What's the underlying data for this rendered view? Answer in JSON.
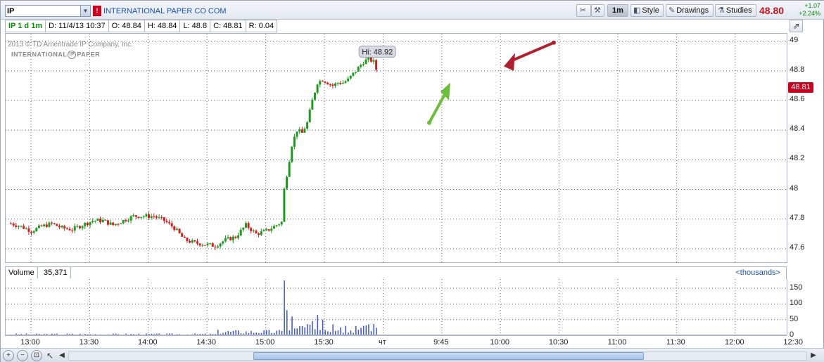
{
  "toolbar": {
    "symbol": "IP",
    "symbol_dropdown_icon": "chevron-down-icon",
    "alert_flag_label": "!",
    "company_name": "INTERNATIONAL PAPER CO COM",
    "interval_label": "1m",
    "style_label": "Style",
    "drawings_label": "Drawings",
    "studies_label": "Studies",
    "last_price": "48.80",
    "change_abs": "+1.07",
    "change_pct": "+2.24%"
  },
  "infobar": {
    "title": "IP 1 d 1m",
    "date": "D: 11/4/13 10:37",
    "open": "O: 48.84",
    "high": "H: 48.84",
    "low": "L: 48.8",
    "close": "C: 48.81",
    "range": "R: 0.04"
  },
  "watermark": {
    "copyright": "2013 © TD Ameritrade IP Company, Inc.",
    "logo_left": "INTERNATIONAL",
    "logo_mark": "IP",
    "logo_right": "PAPER"
  },
  "price_axis": {
    "last_price_tag": "48.81"
  },
  "annotations": {
    "hi_label": "Hi: 48.92"
  },
  "volume": {
    "label": "Volume",
    "value": "35,371",
    "units": "<thousands>"
  },
  "bottombar": {
    "zoom_in_icon": "+",
    "zoom_out_icon": "−",
    "zoom_fit_icon": "⊡",
    "zoom_reset_icon": "○",
    "cursor_icon": "↖",
    "scroll_left_icon": "◀",
    "scroll_right_icon": "▶"
  },
  "colors": {
    "up": "#1e9a1e",
    "down": "#d21e1e",
    "grid": "#666666",
    "volume": "#3a55c8",
    "arrow_green": "#6cbf3a",
    "arrow_red": "#b0202e",
    "last_price": "#cc1020"
  },
  "chart_data": [
    {
      "type": "candlestick",
      "series": [
        {
          "name": "IP"
        }
      ],
      "x_ticks": [
        "13:00",
        "13:30",
        "14:00",
        "14:30",
        "15:00",
        "15:30",
        "чт",
        "9:45",
        "10:00",
        "10:30",
        "11:00",
        "11:30",
        "12:00",
        "12:30",
        "13:00"
      ],
      "y_ticks": [
        47.6,
        47.8,
        48.0,
        48.2,
        48.4,
        48.6,
        48.8,
        49.0
      ],
      "ylim": [
        47.5,
        49.05
      ],
      "grid": true,
      "anchors": [
        [
          0,
          47.77
        ],
        [
          4,
          47.75
        ],
        [
          8,
          47.72
        ],
        [
          12,
          47.75
        ],
        [
          16,
          47.77
        ],
        [
          20,
          47.74
        ],
        [
          24,
          47.73
        ],
        [
          28,
          47.76
        ],
        [
          32,
          47.79
        ],
        [
          36,
          47.79
        ],
        [
          40,
          47.76
        ],
        [
          44,
          47.79
        ],
        [
          48,
          47.82
        ],
        [
          52,
          47.82
        ],
        [
          56,
          47.82
        ],
        [
          60,
          47.79
        ],
        [
          64,
          47.74
        ],
        [
          68,
          47.66
        ],
        [
          72,
          47.64
        ],
        [
          76,
          47.63
        ],
        [
          80,
          47.62
        ],
        [
          84,
          47.66
        ],
        [
          88,
          47.68
        ],
        [
          92,
          47.76
        ],
        [
          96,
          47.7
        ],
        [
          100,
          47.72
        ],
        [
          104,
          47.76
        ],
        [
          106,
          47.78
        ],
        [
          107,
          48.0
        ],
        [
          108,
          48.1
        ],
        [
          109,
          48.2
        ],
        [
          110,
          48.3
        ],
        [
          111,
          48.35
        ],
        [
          112,
          48.4
        ],
        [
          114,
          48.38
        ],
        [
          116,
          48.45
        ],
        [
          118,
          48.6
        ],
        [
          120,
          48.72
        ],
        [
          122,
          48.74
        ],
        [
          124,
          48.72
        ],
        [
          126,
          48.7
        ],
        [
          128,
          48.72
        ],
        [
          130,
          48.72
        ],
        [
          132,
          48.74
        ],
        [
          134,
          48.78
        ],
        [
          136,
          48.82
        ],
        [
          138,
          48.86
        ],
        [
          140,
          48.88
        ],
        [
          142,
          48.86
        ],
        [
          143,
          48.81
        ]
      ],
      "high_annotation": 48.92
    },
    {
      "type": "bar",
      "series": [
        {
          "name": "Volume"
        }
      ],
      "y_ticks": [
        0,
        50,
        100,
        150
      ],
      "ylim": [
        0,
        175
      ],
      "grid": true,
      "spikes": [
        [
          107,
          175
        ],
        [
          108,
          80
        ],
        [
          110,
          60
        ],
        [
          118,
          45
        ],
        [
          120,
          65
        ],
        [
          122,
          50
        ],
        [
          126,
          35
        ],
        [
          131,
          30
        ],
        [
          138,
          30
        ],
        [
          140,
          35
        ]
      ]
    }
  ]
}
